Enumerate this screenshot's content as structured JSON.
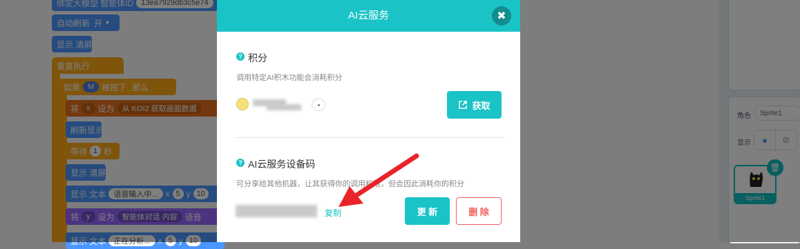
{
  "background_editor": {
    "blocks": {
      "model_prefix": "绑定大模型 智能体ID",
      "model_id": "13ea7929db3c5e74",
      "auto_refresh": "自动刷新",
      "auto_refresh_value": "开",
      "clear_display": "显示 清屏",
      "repeat_forever": "重复执行",
      "if_label": "如果",
      "key_m": "M",
      "pressed": "被按下",
      "then_label": "那么",
      "set_label": "将",
      "var_x": "x",
      "set_to": "设为",
      "from_koi2": "从 KOI2 获取画面数据",
      "refresh_display": "刷新显示",
      "wait_label": "等待",
      "wait_value": "1",
      "seconds": "秒",
      "clear_display2": "显示 清屏",
      "show_text": "显示 文本",
      "voice_input": "语音输入中...",
      "x_label": "x",
      "x_value": "5",
      "y_label": "y",
      "y_value": "10",
      "var_y": "y",
      "agent_dialog": "智能体对话 内容",
      "voice_trunc": "语音",
      "analyzing": "正在分析...",
      "x_value2": "5",
      "y_value2": "10"
    }
  },
  "sprite_panel": {
    "role_label": "角色",
    "sprite_name_field": "Sprite1",
    "show_label": "显示",
    "tile_name": "Sprite1"
  },
  "modal": {
    "title": "AI云服务",
    "close": "✖",
    "points": {
      "title": "积分",
      "description": "调用特定AI积木功能会消耗积分",
      "get_button": "获取"
    },
    "device_code": {
      "title": "AI云服务设备码",
      "description": "可分享给其他机器，让其获得你的调用权限，但会因此消耗你的积分",
      "copy_link": "复制",
      "update_button": "更 新",
      "delete_button": "删 除"
    }
  },
  "colors": {
    "accent": "#1ac3c6",
    "danger": "#f0605c",
    "annotation_arrow": "#e8242a"
  }
}
